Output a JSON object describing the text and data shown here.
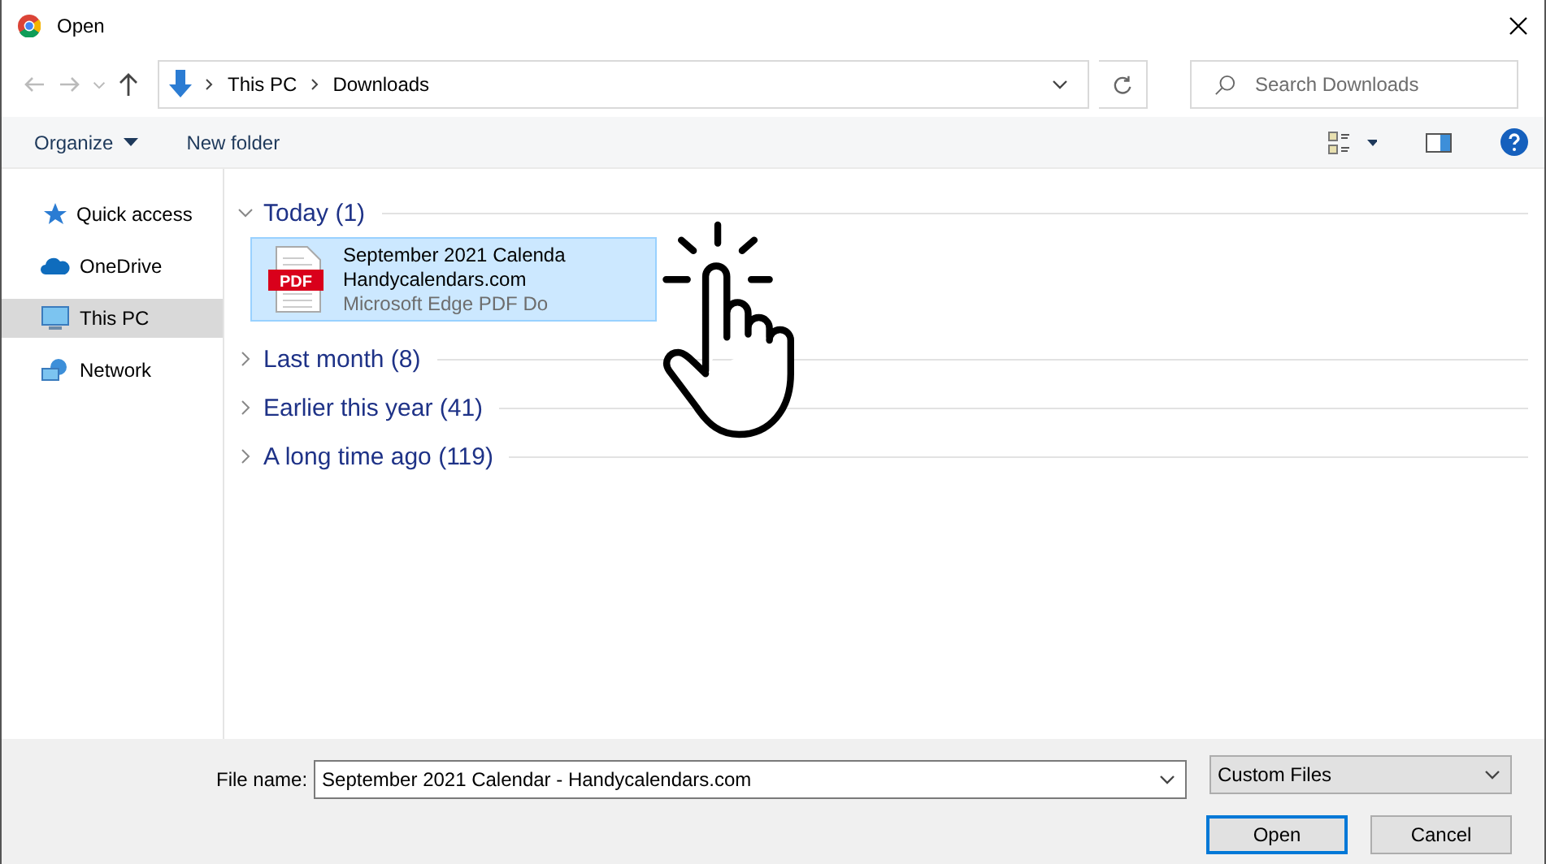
{
  "window": {
    "title": "Open"
  },
  "address": {
    "path": [
      "This PC",
      "Downloads"
    ],
    "search_placeholder": "Search Downloads"
  },
  "toolbar": {
    "organize": "Organize",
    "new_folder": "New folder"
  },
  "sidebar": {
    "items": [
      {
        "label": "Quick access",
        "selected": false
      },
      {
        "label": "OneDrive",
        "selected": false
      },
      {
        "label": "This PC",
        "selected": true
      },
      {
        "label": "Network",
        "selected": false
      }
    ]
  },
  "groups": [
    {
      "label": "Today (1)",
      "expanded": true,
      "files": [
        {
          "lines": [
            "September 2021 Calenda",
            "Handycalendars.com"
          ],
          "type": "Microsoft Edge PDF Do",
          "badge": "PDF",
          "selected": true
        }
      ]
    },
    {
      "label": "Last month (8)",
      "expanded": false
    },
    {
      "label": "Earlier this year (41)",
      "expanded": false
    },
    {
      "label": "A long time ago (119)",
      "expanded": false
    }
  ],
  "footer": {
    "file_name_label": "File name:",
    "file_name": "September 2021 Calendar - Handycalendars.com",
    "filter": "Custom Files",
    "open": "Open",
    "cancel": "Cancel"
  }
}
